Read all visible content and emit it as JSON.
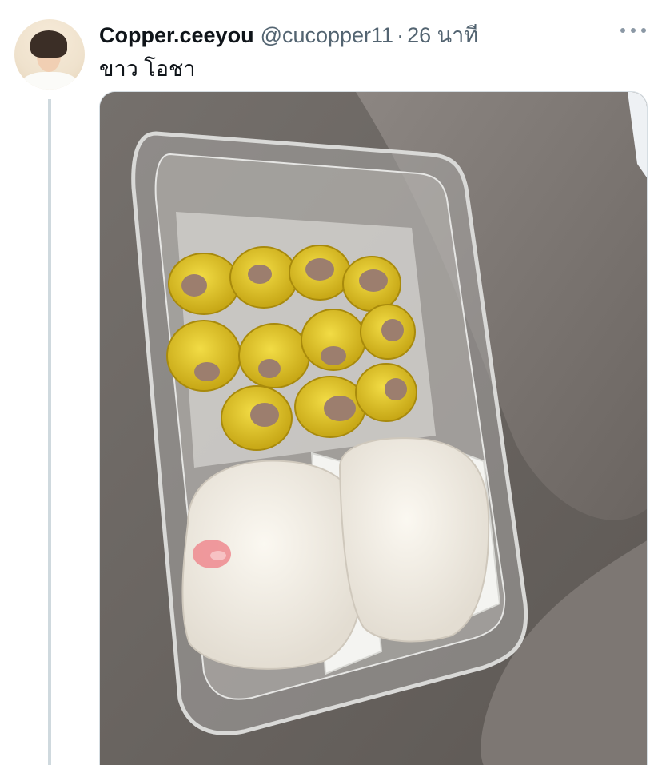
{
  "tweet": {
    "display_name": "Copper.ceeyou",
    "handle": "@cucopper11",
    "separator": "·",
    "time": "26 นาที",
    "text": "ขาว โอชา",
    "more_icon": "more-horizontal-icon",
    "media_alt": ""
  },
  "colors": {
    "handle": "#536471",
    "thread_line": "#cfd9de",
    "text": "#0f1419"
  }
}
